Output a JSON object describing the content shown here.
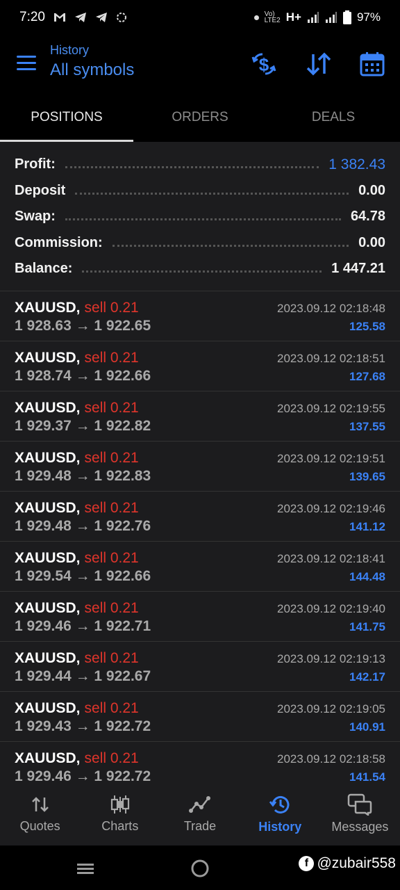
{
  "status_bar": {
    "time": "7:20",
    "battery": "97%",
    "network": "H+"
  },
  "header": {
    "subtitle": "History",
    "title": "All symbols"
  },
  "tabs": [
    {
      "label": "POSITIONS",
      "active": true
    },
    {
      "label": "ORDERS",
      "active": false
    },
    {
      "label": "DEALS",
      "active": false
    }
  ],
  "summary": {
    "profit_label": "Profit:",
    "profit_value": "1 382.43",
    "deposit_label": "Deposit",
    "deposit_value": "0.00",
    "swap_label": "Swap:",
    "swap_value": "64.78",
    "commission_label": "Commission:",
    "commission_value": "0.00",
    "balance_label": "Balance:",
    "balance_value": "1 447.21"
  },
  "deals": [
    {
      "symbol": "XAUUSD,",
      "side": "sell 0.21",
      "prices": "1 928.63 → 1 922.65",
      "time": "2023.09.12 02:18:48",
      "profit": "125.58"
    },
    {
      "symbol": "XAUUSD,",
      "side": "sell 0.21",
      "prices": "1 928.74 → 1 922.66",
      "time": "2023.09.12 02:18:51",
      "profit": "127.68"
    },
    {
      "symbol": "XAUUSD,",
      "side": "sell 0.21",
      "prices": "1 929.37 → 1 922.82",
      "time": "2023.09.12 02:19:55",
      "profit": "137.55"
    },
    {
      "symbol": "XAUUSD,",
      "side": "sell 0.21",
      "prices": "1 929.48 → 1 922.83",
      "time": "2023.09.12 02:19:51",
      "profit": "139.65"
    },
    {
      "symbol": "XAUUSD,",
      "side": "sell 0.21",
      "prices": "1 929.48 → 1 922.76",
      "time": "2023.09.12 02:19:46",
      "profit": "141.12"
    },
    {
      "symbol": "XAUUSD,",
      "side": "sell 0.21",
      "prices": "1 929.54 → 1 922.66",
      "time": "2023.09.12 02:18:41",
      "profit": "144.48"
    },
    {
      "symbol": "XAUUSD,",
      "side": "sell 0.21",
      "prices": "1 929.46 → 1 922.71",
      "time": "2023.09.12 02:19:40",
      "profit": "141.75"
    },
    {
      "symbol": "XAUUSD,",
      "side": "sell 0.21",
      "prices": "1 929.44 → 1 922.67",
      "time": "2023.09.12 02:19:13",
      "profit": "142.17"
    },
    {
      "symbol": "XAUUSD,",
      "side": "sell 0.21",
      "prices": "1 929.43 → 1 922.72",
      "time": "2023.09.12 02:19:05",
      "profit": "140.91"
    },
    {
      "symbol": "XAUUSD,",
      "side": "sell 0.21",
      "prices": "1 929.46 → 1 922.72",
      "time": "2023.09.12 02:18:58",
      "profit": "141.54"
    }
  ],
  "bottom_nav": [
    {
      "label": "Quotes",
      "icon": "quotes-icon",
      "active": false
    },
    {
      "label": "Charts",
      "icon": "charts-icon",
      "active": false
    },
    {
      "label": "Trade",
      "icon": "trade-icon",
      "active": false
    },
    {
      "label": "History",
      "icon": "history-icon",
      "active": true
    },
    {
      "label": "Messages",
      "icon": "messages-icon",
      "active": false
    }
  ],
  "watermark": {
    "text": "@zubair558"
  },
  "colors": {
    "accent": "#3b82f6",
    "sell": "#e0352b",
    "panel": "#1c1c1e"
  }
}
